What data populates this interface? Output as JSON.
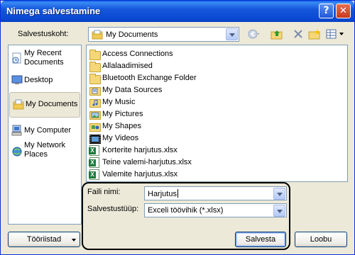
{
  "window": {
    "title": "Nimega salvestamine"
  },
  "titlebar": {
    "help_glyph": "?",
    "close_glyph": "✕"
  },
  "location": {
    "label": "Salvestuskoht:",
    "value": "My Documents",
    "icon": "my-documents-icon"
  },
  "toolbar": {
    "back_icon": "back-icon",
    "up_icon": "up-folder-icon",
    "delete_icon": "delete-icon",
    "new_folder_icon": "new-folder-icon",
    "views_icon": "views-icon"
  },
  "places": [
    {
      "label": "My Recent Documents",
      "icon": "recent-documents-icon"
    },
    {
      "label": "Desktop",
      "icon": "desktop-icon"
    },
    {
      "label": "My Documents",
      "icon": "my-documents-icon",
      "selected": true
    },
    {
      "label": "My Computer",
      "icon": "my-computer-icon"
    },
    {
      "label": "My Network Places",
      "icon": "network-places-icon"
    }
  ],
  "files": [
    {
      "name": "Access Connections",
      "type": "folder"
    },
    {
      "name": "Allalaadimised",
      "type": "folder"
    },
    {
      "name": "Bluetooth Exchange Folder",
      "type": "folder"
    },
    {
      "name": "My Data Sources",
      "type": "special-folder"
    },
    {
      "name": "My Music",
      "type": "special-folder"
    },
    {
      "name": "My Pictures",
      "type": "special-folder"
    },
    {
      "name": "My Shapes",
      "type": "special-folder"
    },
    {
      "name": "My Videos",
      "type": "special-folder"
    },
    {
      "name": "Korterite harjutus.xlsx",
      "type": "xlsx"
    },
    {
      "name": "Teine valemi-harjutus.xlsx",
      "type": "xlsx"
    },
    {
      "name": "Valemite harjutus.xlsx",
      "type": "xlsx"
    }
  ],
  "filename": {
    "label": "Faili nimi:",
    "value": "Harjutus"
  },
  "filetype": {
    "label": "Salvestustüüp:",
    "value": "Exceli töövihik (*.xlsx)"
  },
  "buttons": {
    "tools": "Tööriistad",
    "save": "Salvesta",
    "cancel": "Loobu"
  },
  "colors": {
    "titlebar": "#0a49d2",
    "dialog_bg": "#ece9d8",
    "border": "#7f9db9"
  }
}
